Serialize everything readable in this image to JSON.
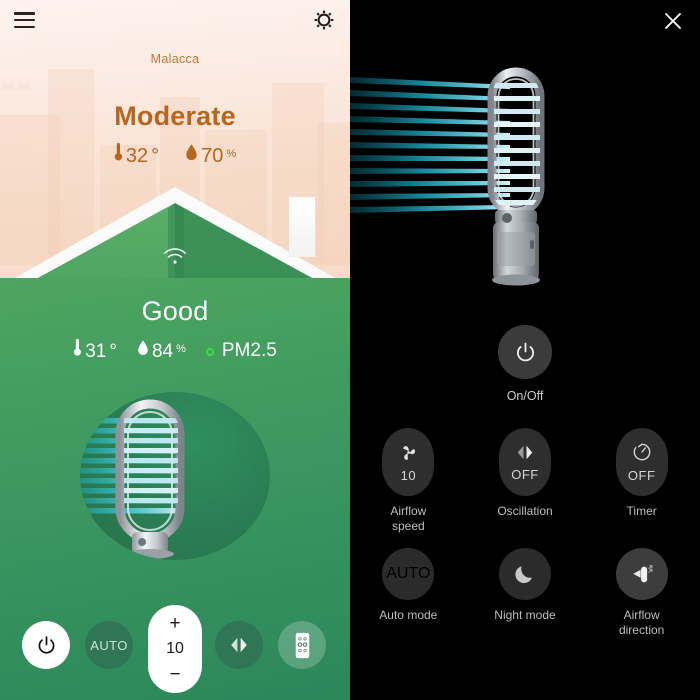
{
  "left_panel": {
    "menu_icon": "hamburger-menu-icon",
    "settings_icon": "gear-icon",
    "city": "Malacca",
    "outdoor": {
      "status": "Moderate",
      "temperature": "32",
      "temperature_unit": "°",
      "humidity": "70",
      "humidity_unit": "%",
      "thermometer_icon": "thermometer-icon",
      "droplet_icon": "water-droplet-icon",
      "color": "#b5661f"
    },
    "wifi_icon": "wifi-icon",
    "indoor": {
      "status": "Good",
      "temperature": "31",
      "temperature_unit": "°",
      "humidity": "84",
      "humidity_unit": "%",
      "pm_label": "PM2.5",
      "pm_status_color": "#3bdc44",
      "color": "#ffffff"
    },
    "device_image": "tower-fan-purifier-with-airflow",
    "controls": {
      "power_label": "power-icon",
      "auto_label": "AUTO",
      "speed_increase": "+",
      "speed_value": "10",
      "speed_decrease": "−",
      "oscillation_icon": "oscillation-icon",
      "remote_icon": "remote-control-icon"
    }
  },
  "right_panel": {
    "close_icon": "close-icon",
    "device_image": "tower-fan-purifier-with-airflow",
    "onoff": {
      "icon": "power-icon",
      "label": "On/Off"
    },
    "buttons": [
      {
        "icon": "fan-blade-icon",
        "value": "10",
        "label": "Airflow\nspeed",
        "shape": "squircle",
        "label_line1": "Airflow",
        "label_line2": "speed"
      },
      {
        "icon": "oscillation-icon",
        "value": "OFF",
        "label": "Oscillation",
        "shape": "squircle",
        "label_line1": "Oscillation",
        "label_line2": ""
      },
      {
        "icon": "timer-icon",
        "value": "OFF",
        "label": "Timer",
        "shape": "squircle",
        "label_line1": "Timer",
        "label_line2": ""
      },
      {
        "icon": "auto-text-icon",
        "value": "AUTO",
        "label": "Auto mode",
        "shape": "circle",
        "label_line1": "Auto mode",
        "label_line2": ""
      },
      {
        "icon": "moon-icon",
        "value": "",
        "label": "Night mode",
        "shape": "circle",
        "label_line1": "Night mode",
        "label_line2": ""
      },
      {
        "icon": "airflow-direction-icon",
        "value": "",
        "label": "Airflow\ndirection",
        "shape": "circle",
        "label_line1": "Airflow",
        "label_line2": "direction"
      }
    ]
  },
  "theme": {
    "outdoor_accent": "#b5661f",
    "indoor_green": "#3d9760",
    "panel_dark": "#000000",
    "airflow_cyan": "#2fbfd4"
  }
}
